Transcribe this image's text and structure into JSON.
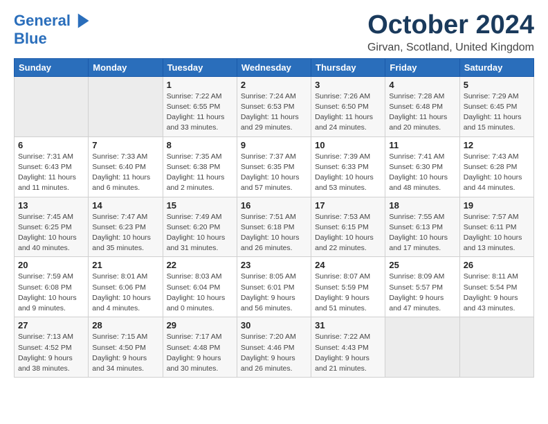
{
  "header": {
    "logo_line1": "General",
    "logo_line2": "Blue",
    "title": "October 2024",
    "location": "Girvan, Scotland, United Kingdom"
  },
  "weekdays": [
    "Sunday",
    "Monday",
    "Tuesday",
    "Wednesday",
    "Thursday",
    "Friday",
    "Saturday"
  ],
  "weeks": [
    [
      {
        "day": "",
        "info": ""
      },
      {
        "day": "",
        "info": ""
      },
      {
        "day": "1",
        "info": "Sunrise: 7:22 AM\nSunset: 6:55 PM\nDaylight: 11 hours\nand 33 minutes."
      },
      {
        "day": "2",
        "info": "Sunrise: 7:24 AM\nSunset: 6:53 PM\nDaylight: 11 hours\nand 29 minutes."
      },
      {
        "day": "3",
        "info": "Sunrise: 7:26 AM\nSunset: 6:50 PM\nDaylight: 11 hours\nand 24 minutes."
      },
      {
        "day": "4",
        "info": "Sunrise: 7:28 AM\nSunset: 6:48 PM\nDaylight: 11 hours\nand 20 minutes."
      },
      {
        "day": "5",
        "info": "Sunrise: 7:29 AM\nSunset: 6:45 PM\nDaylight: 11 hours\nand 15 minutes."
      }
    ],
    [
      {
        "day": "6",
        "info": "Sunrise: 7:31 AM\nSunset: 6:43 PM\nDaylight: 11 hours\nand 11 minutes."
      },
      {
        "day": "7",
        "info": "Sunrise: 7:33 AM\nSunset: 6:40 PM\nDaylight: 11 hours\nand 6 minutes."
      },
      {
        "day": "8",
        "info": "Sunrise: 7:35 AM\nSunset: 6:38 PM\nDaylight: 11 hours\nand 2 minutes."
      },
      {
        "day": "9",
        "info": "Sunrise: 7:37 AM\nSunset: 6:35 PM\nDaylight: 10 hours\nand 57 minutes."
      },
      {
        "day": "10",
        "info": "Sunrise: 7:39 AM\nSunset: 6:33 PM\nDaylight: 10 hours\nand 53 minutes."
      },
      {
        "day": "11",
        "info": "Sunrise: 7:41 AM\nSunset: 6:30 PM\nDaylight: 10 hours\nand 48 minutes."
      },
      {
        "day": "12",
        "info": "Sunrise: 7:43 AM\nSunset: 6:28 PM\nDaylight: 10 hours\nand 44 minutes."
      }
    ],
    [
      {
        "day": "13",
        "info": "Sunrise: 7:45 AM\nSunset: 6:25 PM\nDaylight: 10 hours\nand 40 minutes."
      },
      {
        "day": "14",
        "info": "Sunrise: 7:47 AM\nSunset: 6:23 PM\nDaylight: 10 hours\nand 35 minutes."
      },
      {
        "day": "15",
        "info": "Sunrise: 7:49 AM\nSunset: 6:20 PM\nDaylight: 10 hours\nand 31 minutes."
      },
      {
        "day": "16",
        "info": "Sunrise: 7:51 AM\nSunset: 6:18 PM\nDaylight: 10 hours\nand 26 minutes."
      },
      {
        "day": "17",
        "info": "Sunrise: 7:53 AM\nSunset: 6:15 PM\nDaylight: 10 hours\nand 22 minutes."
      },
      {
        "day": "18",
        "info": "Sunrise: 7:55 AM\nSunset: 6:13 PM\nDaylight: 10 hours\nand 17 minutes."
      },
      {
        "day": "19",
        "info": "Sunrise: 7:57 AM\nSunset: 6:11 PM\nDaylight: 10 hours\nand 13 minutes."
      }
    ],
    [
      {
        "day": "20",
        "info": "Sunrise: 7:59 AM\nSunset: 6:08 PM\nDaylight: 10 hours\nand 9 minutes."
      },
      {
        "day": "21",
        "info": "Sunrise: 8:01 AM\nSunset: 6:06 PM\nDaylight: 10 hours\nand 4 minutes."
      },
      {
        "day": "22",
        "info": "Sunrise: 8:03 AM\nSunset: 6:04 PM\nDaylight: 10 hours\nand 0 minutes."
      },
      {
        "day": "23",
        "info": "Sunrise: 8:05 AM\nSunset: 6:01 PM\nDaylight: 9 hours\nand 56 minutes."
      },
      {
        "day": "24",
        "info": "Sunrise: 8:07 AM\nSunset: 5:59 PM\nDaylight: 9 hours\nand 51 minutes."
      },
      {
        "day": "25",
        "info": "Sunrise: 8:09 AM\nSunset: 5:57 PM\nDaylight: 9 hours\nand 47 minutes."
      },
      {
        "day": "26",
        "info": "Sunrise: 8:11 AM\nSunset: 5:54 PM\nDaylight: 9 hours\nand 43 minutes."
      }
    ],
    [
      {
        "day": "27",
        "info": "Sunrise: 7:13 AM\nSunset: 4:52 PM\nDaylight: 9 hours\nand 38 minutes."
      },
      {
        "day": "28",
        "info": "Sunrise: 7:15 AM\nSunset: 4:50 PM\nDaylight: 9 hours\nand 34 minutes."
      },
      {
        "day": "29",
        "info": "Sunrise: 7:17 AM\nSunset: 4:48 PM\nDaylight: 9 hours\nand 30 minutes."
      },
      {
        "day": "30",
        "info": "Sunrise: 7:20 AM\nSunset: 4:46 PM\nDaylight: 9 hours\nand 26 minutes."
      },
      {
        "day": "31",
        "info": "Sunrise: 7:22 AM\nSunset: 4:43 PM\nDaylight: 9 hours\nand 21 minutes."
      },
      {
        "day": "",
        "info": ""
      },
      {
        "day": "",
        "info": ""
      }
    ]
  ]
}
